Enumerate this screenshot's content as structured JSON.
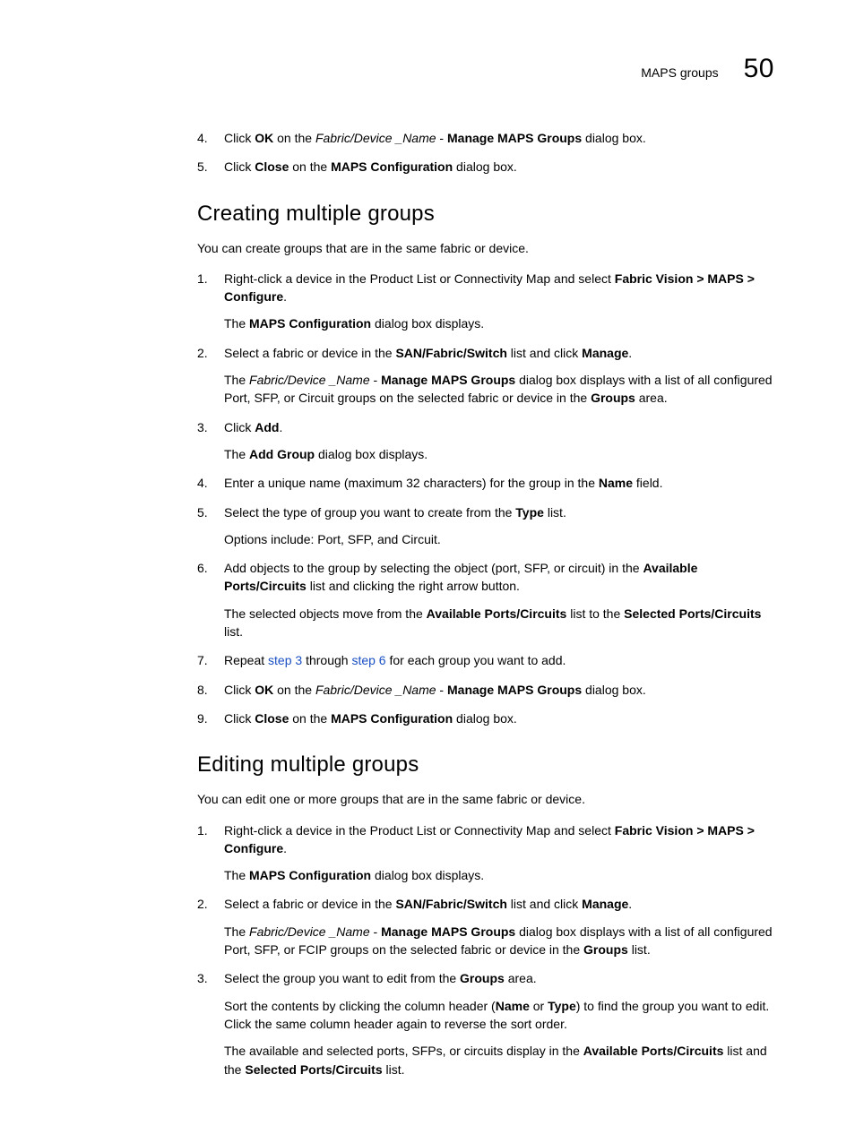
{
  "header": {
    "label": "MAPS groups",
    "page_number": "50"
  },
  "top_steps": [
    {
      "num": "4.",
      "runs": [
        {
          "t": "Click "
        },
        {
          "t": "OK",
          "b": true
        },
        {
          "t": " on the "
        },
        {
          "t": "Fabric/Device _Name",
          "i": true
        },
        {
          "t": " - "
        },
        {
          "t": "Manage MAPS Groups",
          "b": true
        },
        {
          "t": " dialog box."
        }
      ]
    },
    {
      "num": "5.",
      "runs": [
        {
          "t": "Click "
        },
        {
          "t": "Close",
          "b": true
        },
        {
          "t": " on the "
        },
        {
          "t": "MAPS Configuration",
          "b": true
        },
        {
          "t": " dialog box."
        }
      ]
    }
  ],
  "section1": {
    "heading": "Creating multiple groups",
    "intro": "You can create groups that are in the same fabric or device.",
    "steps": [
      {
        "num": "1.",
        "runs": [
          {
            "t": "Right-click a device in the Product List or Connectivity Map and select "
          },
          {
            "t": "Fabric Vision > MAPS > Configure",
            "b": true
          },
          {
            "t": "."
          }
        ],
        "follow": [
          [
            {
              "t": "The "
            },
            {
              "t": "MAPS Configuration",
              "b": true
            },
            {
              "t": " dialog box displays."
            }
          ]
        ]
      },
      {
        "num": "2.",
        "runs": [
          {
            "t": "Select a fabric or device in the "
          },
          {
            "t": "SAN/Fabric/Switch",
            "b": true
          },
          {
            "t": " list and click "
          },
          {
            "t": "Manage",
            "b": true
          },
          {
            "t": "."
          }
        ],
        "follow": [
          [
            {
              "t": "The "
            },
            {
              "t": "Fabric/Device _Name",
              "i": true
            },
            {
              "t": " - "
            },
            {
              "t": "Manage MAPS Groups",
              "b": true
            },
            {
              "t": " dialog box displays with a list of all configured Port, SFP, or Circuit groups on the selected fabric or device in the "
            },
            {
              "t": "Groups",
              "b": true
            },
            {
              "t": " area."
            }
          ]
        ]
      },
      {
        "num": "3.",
        "runs": [
          {
            "t": "Click "
          },
          {
            "t": "Add",
            "b": true
          },
          {
            "t": "."
          }
        ],
        "follow": [
          [
            {
              "t": "The "
            },
            {
              "t": "Add Group",
              "b": true
            },
            {
              "t": " dialog box displays."
            }
          ]
        ]
      },
      {
        "num": "4.",
        "runs": [
          {
            "t": "Enter a unique name (maximum 32 characters) for the group in the "
          },
          {
            "t": "Name",
            "b": true
          },
          {
            "t": " field."
          }
        ]
      },
      {
        "num": "5.",
        "runs": [
          {
            "t": "Select the type of group you want to create from the "
          },
          {
            "t": "Type",
            "b": true
          },
          {
            "t": " list."
          }
        ],
        "follow": [
          [
            {
              "t": "Options include: Port, SFP, and Circuit."
            }
          ]
        ]
      },
      {
        "num": "6.",
        "runs": [
          {
            "t": "Add objects to the group by selecting the object (port, SFP, or circuit) in the "
          },
          {
            "t": "Available Ports/Circuits",
            "b": true
          },
          {
            "t": " list and clicking the right arrow button."
          }
        ],
        "follow": [
          [
            {
              "t": "The selected objects move from the "
            },
            {
              "t": "Available Ports/Circuits",
              "b": true
            },
            {
              "t": " list to the "
            },
            {
              "t": "Selected Ports/Circuits",
              "b": true
            },
            {
              "t": " list."
            }
          ]
        ]
      },
      {
        "num": "7.",
        "runs": [
          {
            "t": "Repeat "
          },
          {
            "t": "step 3",
            "link": true
          },
          {
            "t": " through "
          },
          {
            "t": "step 6",
            "link": true
          },
          {
            "t": " for each group you want to add."
          }
        ]
      },
      {
        "num": "8.",
        "runs": [
          {
            "t": "Click "
          },
          {
            "t": "OK",
            "b": true
          },
          {
            "t": " on the "
          },
          {
            "t": "Fabric/Device _Name",
            "i": true
          },
          {
            "t": " - "
          },
          {
            "t": "Manage MAPS Groups",
            "b": true
          },
          {
            "t": " dialog box."
          }
        ]
      },
      {
        "num": "9.",
        "runs": [
          {
            "t": "Click "
          },
          {
            "t": "Close",
            "b": true
          },
          {
            "t": " on the "
          },
          {
            "t": "MAPS Configuration",
            "b": true
          },
          {
            "t": " dialog box."
          }
        ]
      }
    ]
  },
  "section2": {
    "heading": "Editing multiple groups",
    "intro": "You can edit one or more groups that are in the same fabric or device.",
    "steps": [
      {
        "num": "1.",
        "runs": [
          {
            "t": "Right-click a device in the Product List or Connectivity Map and select "
          },
          {
            "t": "Fabric Vision > MAPS > Configure",
            "b": true
          },
          {
            "t": "."
          }
        ],
        "follow": [
          [
            {
              "t": "The "
            },
            {
              "t": "MAPS Configuration",
              "b": true
            },
            {
              "t": " dialog box displays."
            }
          ]
        ]
      },
      {
        "num": "2.",
        "runs": [
          {
            "t": "Select a fabric or device in the "
          },
          {
            "t": "SAN/Fabric/Switch",
            "b": true
          },
          {
            "t": " list and click "
          },
          {
            "t": "Manage",
            "b": true
          },
          {
            "t": "."
          }
        ],
        "follow": [
          [
            {
              "t": "The "
            },
            {
              "t": "Fabric/Device _Name",
              "i": true
            },
            {
              "t": " - "
            },
            {
              "t": "Manage MAPS Groups",
              "b": true
            },
            {
              "t": " dialog box displays with a list of all configured Port, SFP, or FCIP groups on the selected fabric or device in the "
            },
            {
              "t": "Groups",
              "b": true
            },
            {
              "t": " list."
            }
          ]
        ]
      },
      {
        "num": "3.",
        "runs": [
          {
            "t": "Select the group you want to edit from the "
          },
          {
            "t": "Groups",
            "b": true
          },
          {
            "t": " area."
          }
        ],
        "follow": [
          [
            {
              "t": "Sort the contents by clicking the column header ("
            },
            {
              "t": "Name",
              "b": true
            },
            {
              "t": " or "
            },
            {
              "t": "Type",
              "b": true
            },
            {
              "t": ") to find the group you want to edit. Click the same column header again to reverse the sort order."
            }
          ],
          [
            {
              "t": "The available and selected ports, SFPs, or circuits display in the "
            },
            {
              "t": "Available Ports/Circuits",
              "b": true
            },
            {
              "t": " list and the "
            },
            {
              "t": "Selected Ports/Circuits",
              "b": true
            },
            {
              "t": " list."
            }
          ]
        ]
      }
    ]
  }
}
